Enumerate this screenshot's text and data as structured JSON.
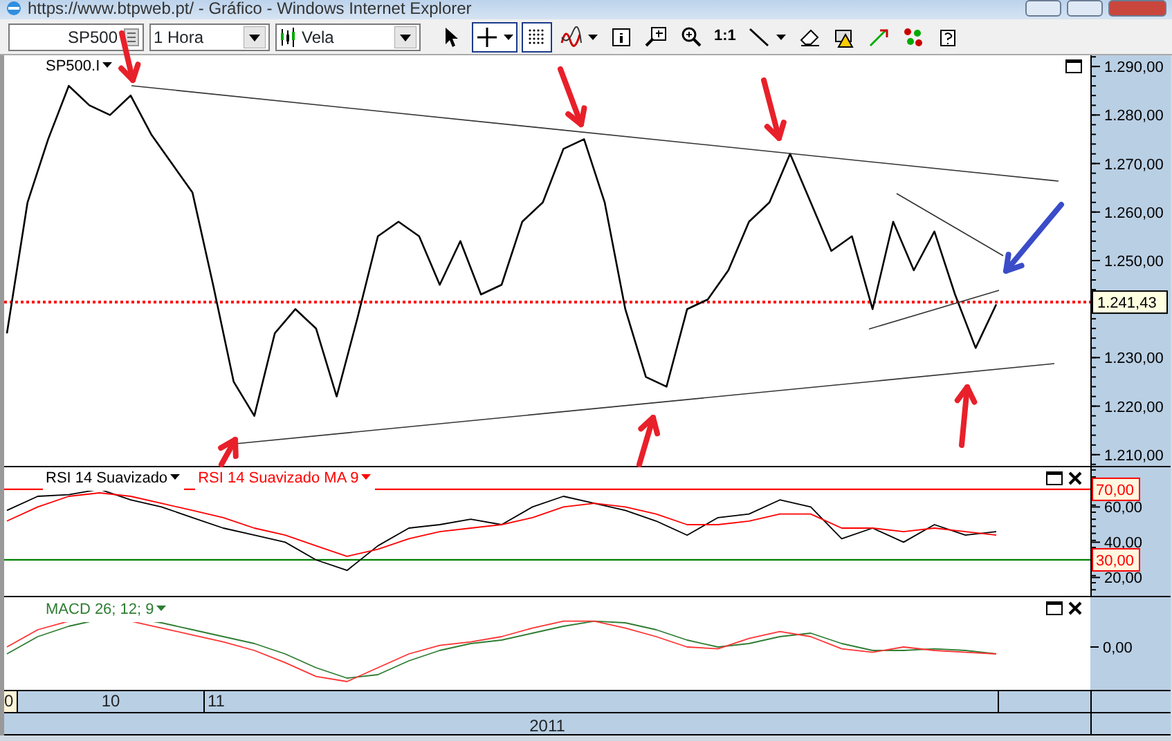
{
  "window": {
    "title": "https://www.btpweb.pt/ - Gráfico - Windows Internet Explorer"
  },
  "toolbar": {
    "symbol": "SP500",
    "interval": "1 Hora",
    "chart_type": "Vela",
    "tools": [
      {
        "kind": "cursor",
        "selected": false,
        "dropdown": false
      },
      {
        "kind": "crosshair",
        "selected": true,
        "dropdown": true
      },
      {
        "kind": "grid",
        "selected": true,
        "dropdown": false
      },
      {
        "kind": "indicator",
        "selected": false,
        "dropdown": true
      },
      {
        "kind": "info",
        "selected": false,
        "dropdown": false
      },
      {
        "kind": "zoom-box",
        "selected": false,
        "dropdown": false
      },
      {
        "kind": "zoom",
        "selected": false,
        "dropdown": false
      },
      {
        "kind": "actual-size",
        "label": "1:1",
        "selected": false,
        "dropdown": false
      },
      {
        "kind": "line",
        "selected": false,
        "dropdown": true
      },
      {
        "kind": "eraser",
        "selected": false,
        "dropdown": false
      },
      {
        "kind": "alert",
        "selected": false,
        "dropdown": false
      },
      {
        "kind": "arrow",
        "selected": false,
        "dropdown": false
      },
      {
        "kind": "color",
        "selected": false,
        "dropdown": false
      },
      {
        "kind": "help",
        "selected": false,
        "dropdown": false
      }
    ]
  },
  "price_panel": {
    "chart_data": {
      "type": "line",
      "ylim": [
        1207.4,
        1292.3
      ],
      "yticks": [
        {
          "value": 1210,
          "label": "1.210,00"
        },
        {
          "value": 1220,
          "label": "1.220,00"
        },
        {
          "value": 1230,
          "label": "1.230,00"
        },
        {
          "value": 1250,
          "label": "1.250,00"
        },
        {
          "value": 1260,
          "label": "1.260,00"
        },
        {
          "value": 1270,
          "label": "1.270,00"
        },
        {
          "value": 1280,
          "label": "1.280,00"
        },
        {
          "value": 1290,
          "label": "1.290,00"
        }
      ],
      "series": [
        {
          "name": "SP500.I",
          "color": "#000000",
          "values": [
            1235,
            1262,
            1275,
            1286,
            1282,
            1280,
            1284,
            1276,
            1270,
            1264,
            1245,
            1225,
            1218,
            1235,
            1240,
            1236,
            1222,
            1238,
            1255,
            1258,
            1255,
            1245,
            1254,
            1243,
            1245,
            1258,
            1262,
            1273,
            1275,
            1262,
            1240,
            1226,
            1224,
            1240,
            1242,
            1248,
            1258,
            1262,
            1272,
            1262,
            1252,
            1255,
            1240,
            1258,
            1248,
            1256,
            1243,
            1232,
            1241
          ]
        }
      ],
      "legend": "top-left",
      "ref_lines": [
        {
          "axis": "y",
          "value": 1241.43,
          "label": "1.241,43",
          "color": "#ff0000"
        }
      ]
    }
  },
  "rsi_panel": {
    "chart_data": {
      "type": "line",
      "ylim": [
        8.8,
        82.5
      ],
      "yticks": [
        {
          "value": 20,
          "label": "20,00"
        },
        {
          "value": 40,
          "label": "40,00"
        },
        {
          "value": 60,
          "label": "60,00"
        }
      ],
      "series": [
        {
          "name": "RSI 14 Suavizado",
          "color": "#000000",
          "values": [
            58,
            66,
            67,
            70,
            64,
            60,
            54,
            48,
            44,
            40,
            30,
            24,
            38,
            48,
            50,
            53,
            50,
            60,
            66,
            62,
            58,
            52,
            44,
            54,
            56,
            64,
            60,
            42,
            48,
            40,
            50,
            44,
            46
          ]
        },
        {
          "name": "RSI 14 Suavizado MA 9",
          "color": "#ff0000",
          "values": [
            52,
            60,
            66,
            68,
            66,
            62,
            58,
            54,
            48,
            44,
            38,
            32,
            36,
            42,
            46,
            48,
            50,
            54,
            60,
            62,
            60,
            56,
            50,
            50,
            52,
            56,
            56,
            48,
            48,
            46,
            48,
            46,
            44
          ]
        }
      ],
      "legend": "top-left",
      "ref_lines": [
        {
          "axis": "y",
          "value": 70,
          "label": "70,00",
          "color": "#ff0000"
        },
        {
          "axis": "y",
          "value": 30,
          "label": "30,00",
          "color": "#008000"
        }
      ]
    }
  },
  "macd_panel": {
    "legend": "MACD 26; 12; 9",
    "axis_label": "0,00"
  },
  "x_axis": {
    "periods": [
      "0",
      "10",
      "11"
    ],
    "year": "2011"
  }
}
